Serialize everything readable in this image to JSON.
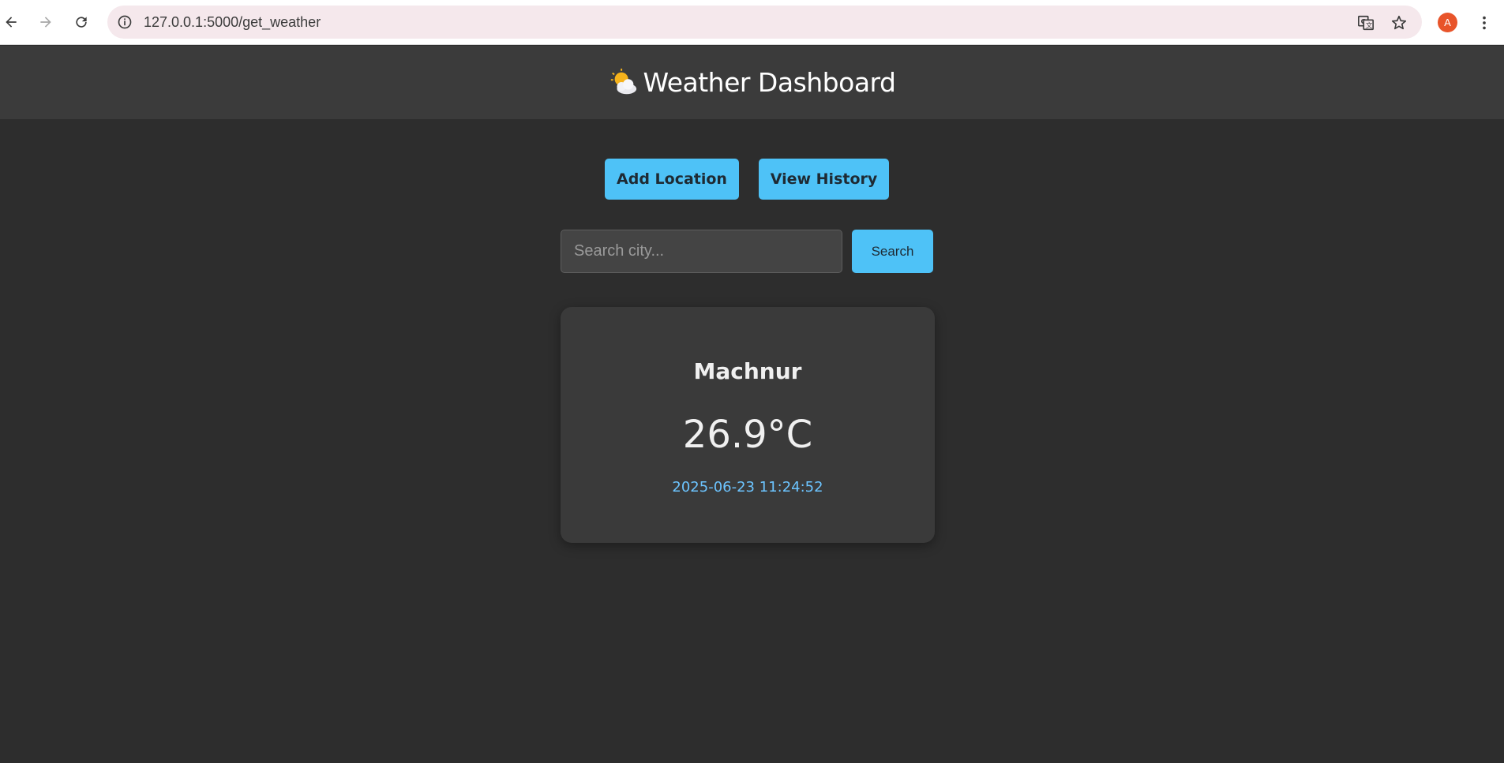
{
  "browser": {
    "url": "127.0.0.1:5000/get_weather",
    "avatar_letter": "A",
    "icons": [
      "back-arrow-icon",
      "forward-arrow-icon",
      "reload-icon",
      "info-icon",
      "translate-icon",
      "star-icon",
      "more-vert-icon"
    ]
  },
  "header": {
    "title": "Weather Dashboard",
    "icon": "sun-behind-cloud-icon"
  },
  "actions": {
    "add_location_label": "Add Location",
    "view_history_label": "View History"
  },
  "search": {
    "placeholder": "Search city...",
    "value": "",
    "button_label": "Search"
  },
  "weather": {
    "city": "Machnur",
    "temperature": "26.9°C",
    "timestamp": "2025-06-23 11:24:52"
  },
  "colors": {
    "accent": "#4ec2f7",
    "page_bg": "#2d2d2d",
    "header_bg": "#3b3b3b",
    "card_bg": "#3a3a3a",
    "timestamp": "#6cc4ff"
  }
}
